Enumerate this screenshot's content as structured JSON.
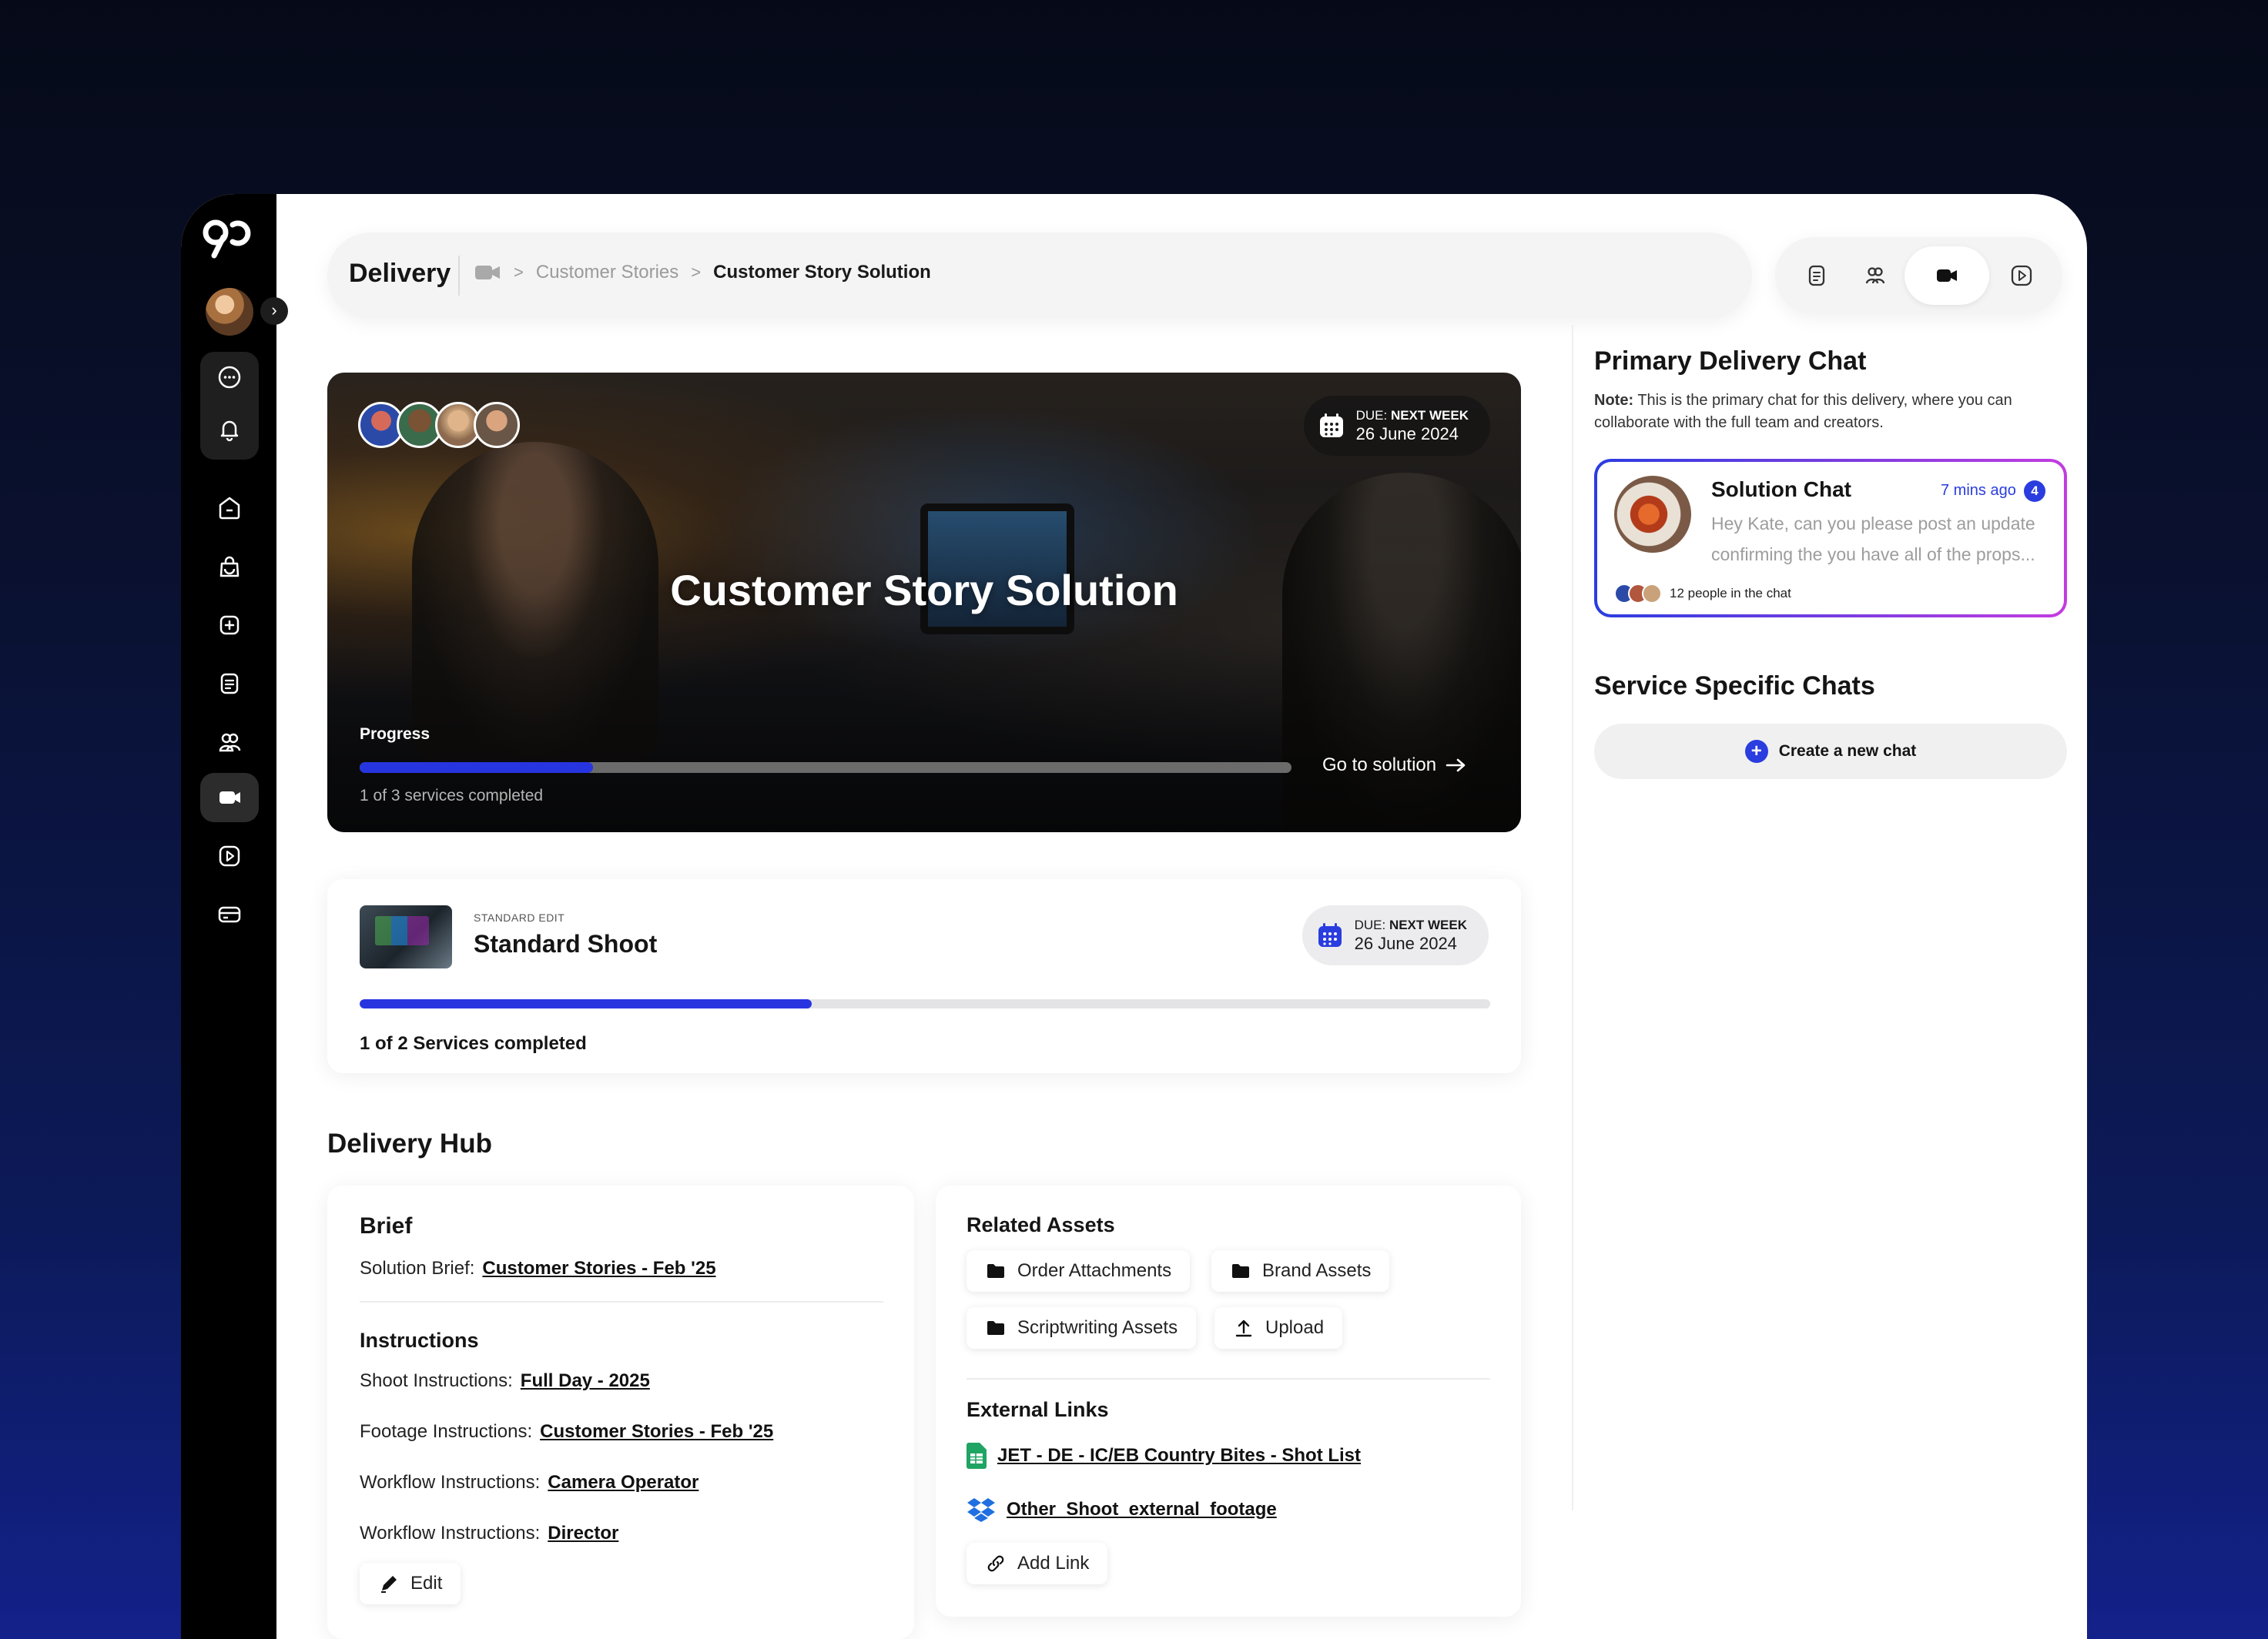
{
  "header": {
    "title": "Delivery",
    "breadcrumb": [
      "Customer Stories",
      "Customer Story Solution"
    ]
  },
  "sidebar": {
    "icons": [
      "chat-icon",
      "bell-icon",
      "home-icon",
      "bag-icon",
      "add-icon",
      "document-icon",
      "team-icon",
      "video-camera-icon",
      "play-icon",
      "card-icon"
    ],
    "active": "video-camera-icon"
  },
  "top_tabs": [
    "document-icon",
    "team-icon",
    "video-camera-icon",
    "play-icon"
  ],
  "hero": {
    "title": "Customer Story Solution",
    "due_prefix": "DUE:",
    "due_label": "NEXT WEEK",
    "due_date": "26 June 2024",
    "progress_label": "Progress",
    "progress_fraction": 0.25,
    "progress_text": "1 of 3 services completed",
    "go_to_solution": "Go to solution"
  },
  "service": {
    "kicker": "STANDARD EDIT",
    "name": "Standard Shoot",
    "due_prefix": "DUE:",
    "due_label": "NEXT WEEK",
    "due_date": "26 June 2024",
    "progress_fraction": 0.4,
    "progress_text": "1 of 2 Services completed"
  },
  "hub": {
    "title": "Delivery Hub",
    "brief": {
      "title": "Brief",
      "solution_brief_label": "Solution Brief:",
      "solution_brief_link": "Customer Stories - Feb '25",
      "instructions_title": "Instructions",
      "rows": [
        {
          "label": "Shoot Instructions:",
          "link": "Full Day - 2025"
        },
        {
          "label": "Footage Instructions:",
          "link": "Customer Stories - Feb '25"
        },
        {
          "label": "Workflow Instructions:",
          "link": "Camera Operator"
        },
        {
          "label": "Workflow Instructions:",
          "link": "Director"
        }
      ],
      "edit_label": "Edit"
    },
    "assets": {
      "title": "Related Assets",
      "chips": [
        "Order Attachments",
        "Brand Assets",
        "Scriptwriting Assets",
        "Upload"
      ],
      "links_title": "External Links",
      "links": [
        "JET - DE - IC/EB Country Bites - Shot List",
        "Other_Shoot_external_footage"
      ],
      "add_link": "Add Link"
    }
  },
  "right": {
    "primary_title": "Primary Delivery Chat",
    "note_bold": "Note:",
    "note_text": "This is the primary chat for this delivery, where you can collaborate with the full team and creators.",
    "chat": {
      "name": "Solution Chat",
      "time": "7 mins ago",
      "unread": "4",
      "message": "Hey Kate, can you please post an update confirming the you have all of the props...",
      "people": "12 people in the chat"
    },
    "service_title": "Service Specific Chats",
    "new_chat": "Create a new chat"
  },
  "colors": {
    "accent": "#2735e0",
    "background_top": "#060a18",
    "background_bottom": "#13218a"
  }
}
